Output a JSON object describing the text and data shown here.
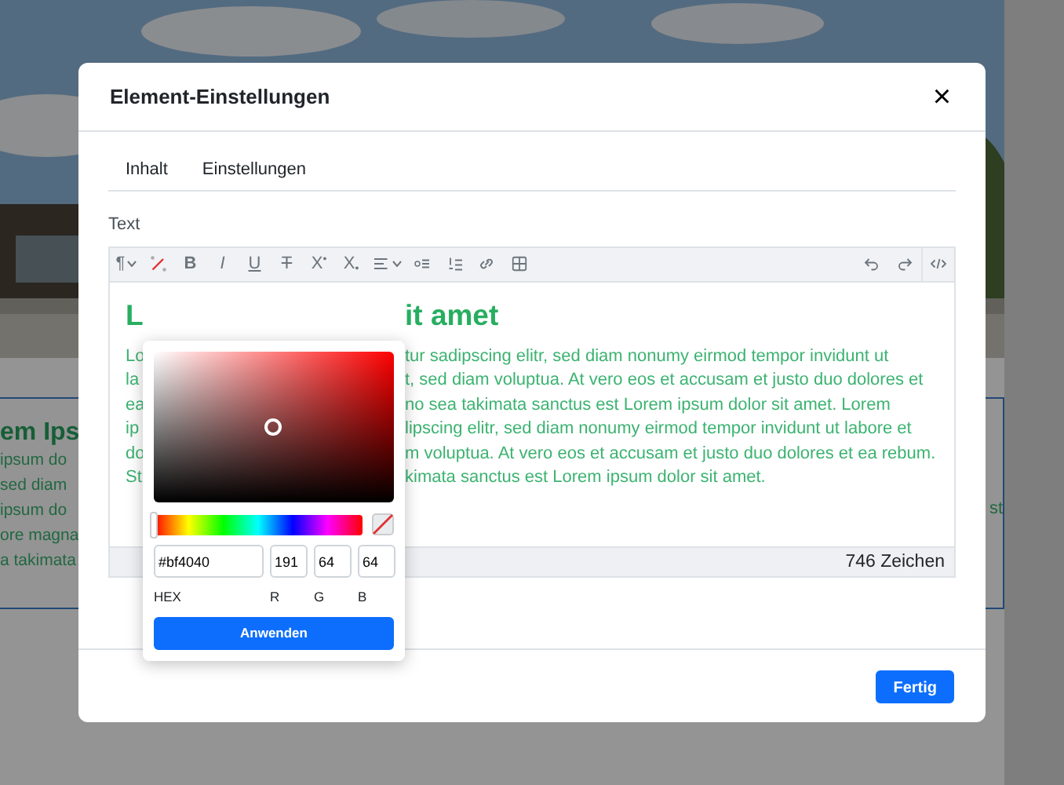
{
  "background_page": {
    "heading": "em Ips",
    "lines": [
      "ipsum do",
      "sed diam",
      "ipsum do",
      "ore magna",
      "a takimata"
    ],
    "right_fragment": "st"
  },
  "modal": {
    "title": "Element-Einstellungen",
    "close": "×",
    "tabs": [
      {
        "label": "Inhalt",
        "selected": false
      },
      {
        "label": "Einstellungen",
        "selected": false
      }
    ],
    "field_label": "Text",
    "toolbar": {
      "groups": [
        [
          {
            "kind": "text",
            "label": "¶",
            "caret": true
          },
          {
            "kind": "color"
          },
          {
            "kind": "bold",
            "label": "B"
          },
          {
            "kind": "italic",
            "label": "I"
          },
          {
            "kind": "underline",
            "label": "U"
          },
          {
            "kind": "strike",
            "label": "T"
          },
          {
            "kind": "text",
            "label": "X$^{•}$"
          },
          {
            "kind": "text",
            "label": "X$_{•}$"
          },
          {
            "kind": "align",
            "caret": true
          },
          {
            "kind": "bullets"
          },
          {
            "kind": "numbers"
          },
          {
            "kind": "link"
          },
          {
            "kind": "table"
          }
        ],
        [
          {
            "kind": "undo"
          },
          {
            "kind": "redo"
          }
        ],
        [
          {
            "kind": "code"
          }
        ]
      ]
    },
    "editor": {
      "heading": {
        "left": "L",
        "right": "it amet"
      },
      "lines": [
        {
          "left": "Lo",
          "right": "tur sadipscing elitr, sed diam nonumy eirmod tempor invidunt ut"
        },
        {
          "left": "la",
          "right": "t, sed diam voluptua. At vero eos et accusam et justo duo dolores et"
        },
        {
          "left": "ea",
          "right": "no sea takimata sanctus est Lorem ipsum dolor sit amet. Lorem"
        },
        {
          "left": "ip",
          "right": "lipscing elitr, sed diam nonumy eirmod tempor invidunt ut labore et"
        },
        {
          "left": "do",
          "right": "m voluptua. At vero eos et accusam et justo duo dolores et ea rebum."
        },
        {
          "left": "St",
          "right": "kimata sanctus est Lorem ipsum dolor sit amet."
        }
      ],
      "count": "746 Zeichen"
    },
    "color_picker": {
      "hue": {
        "level": 0
      },
      "hex": "#bf4040",
      "r": "191",
      "g": "64",
      "b": "64",
      "labels": [
        "HEX",
        "R",
        "G",
        "B"
      ],
      "apply": "Anwenden"
    },
    "done": "Fertig"
  }
}
